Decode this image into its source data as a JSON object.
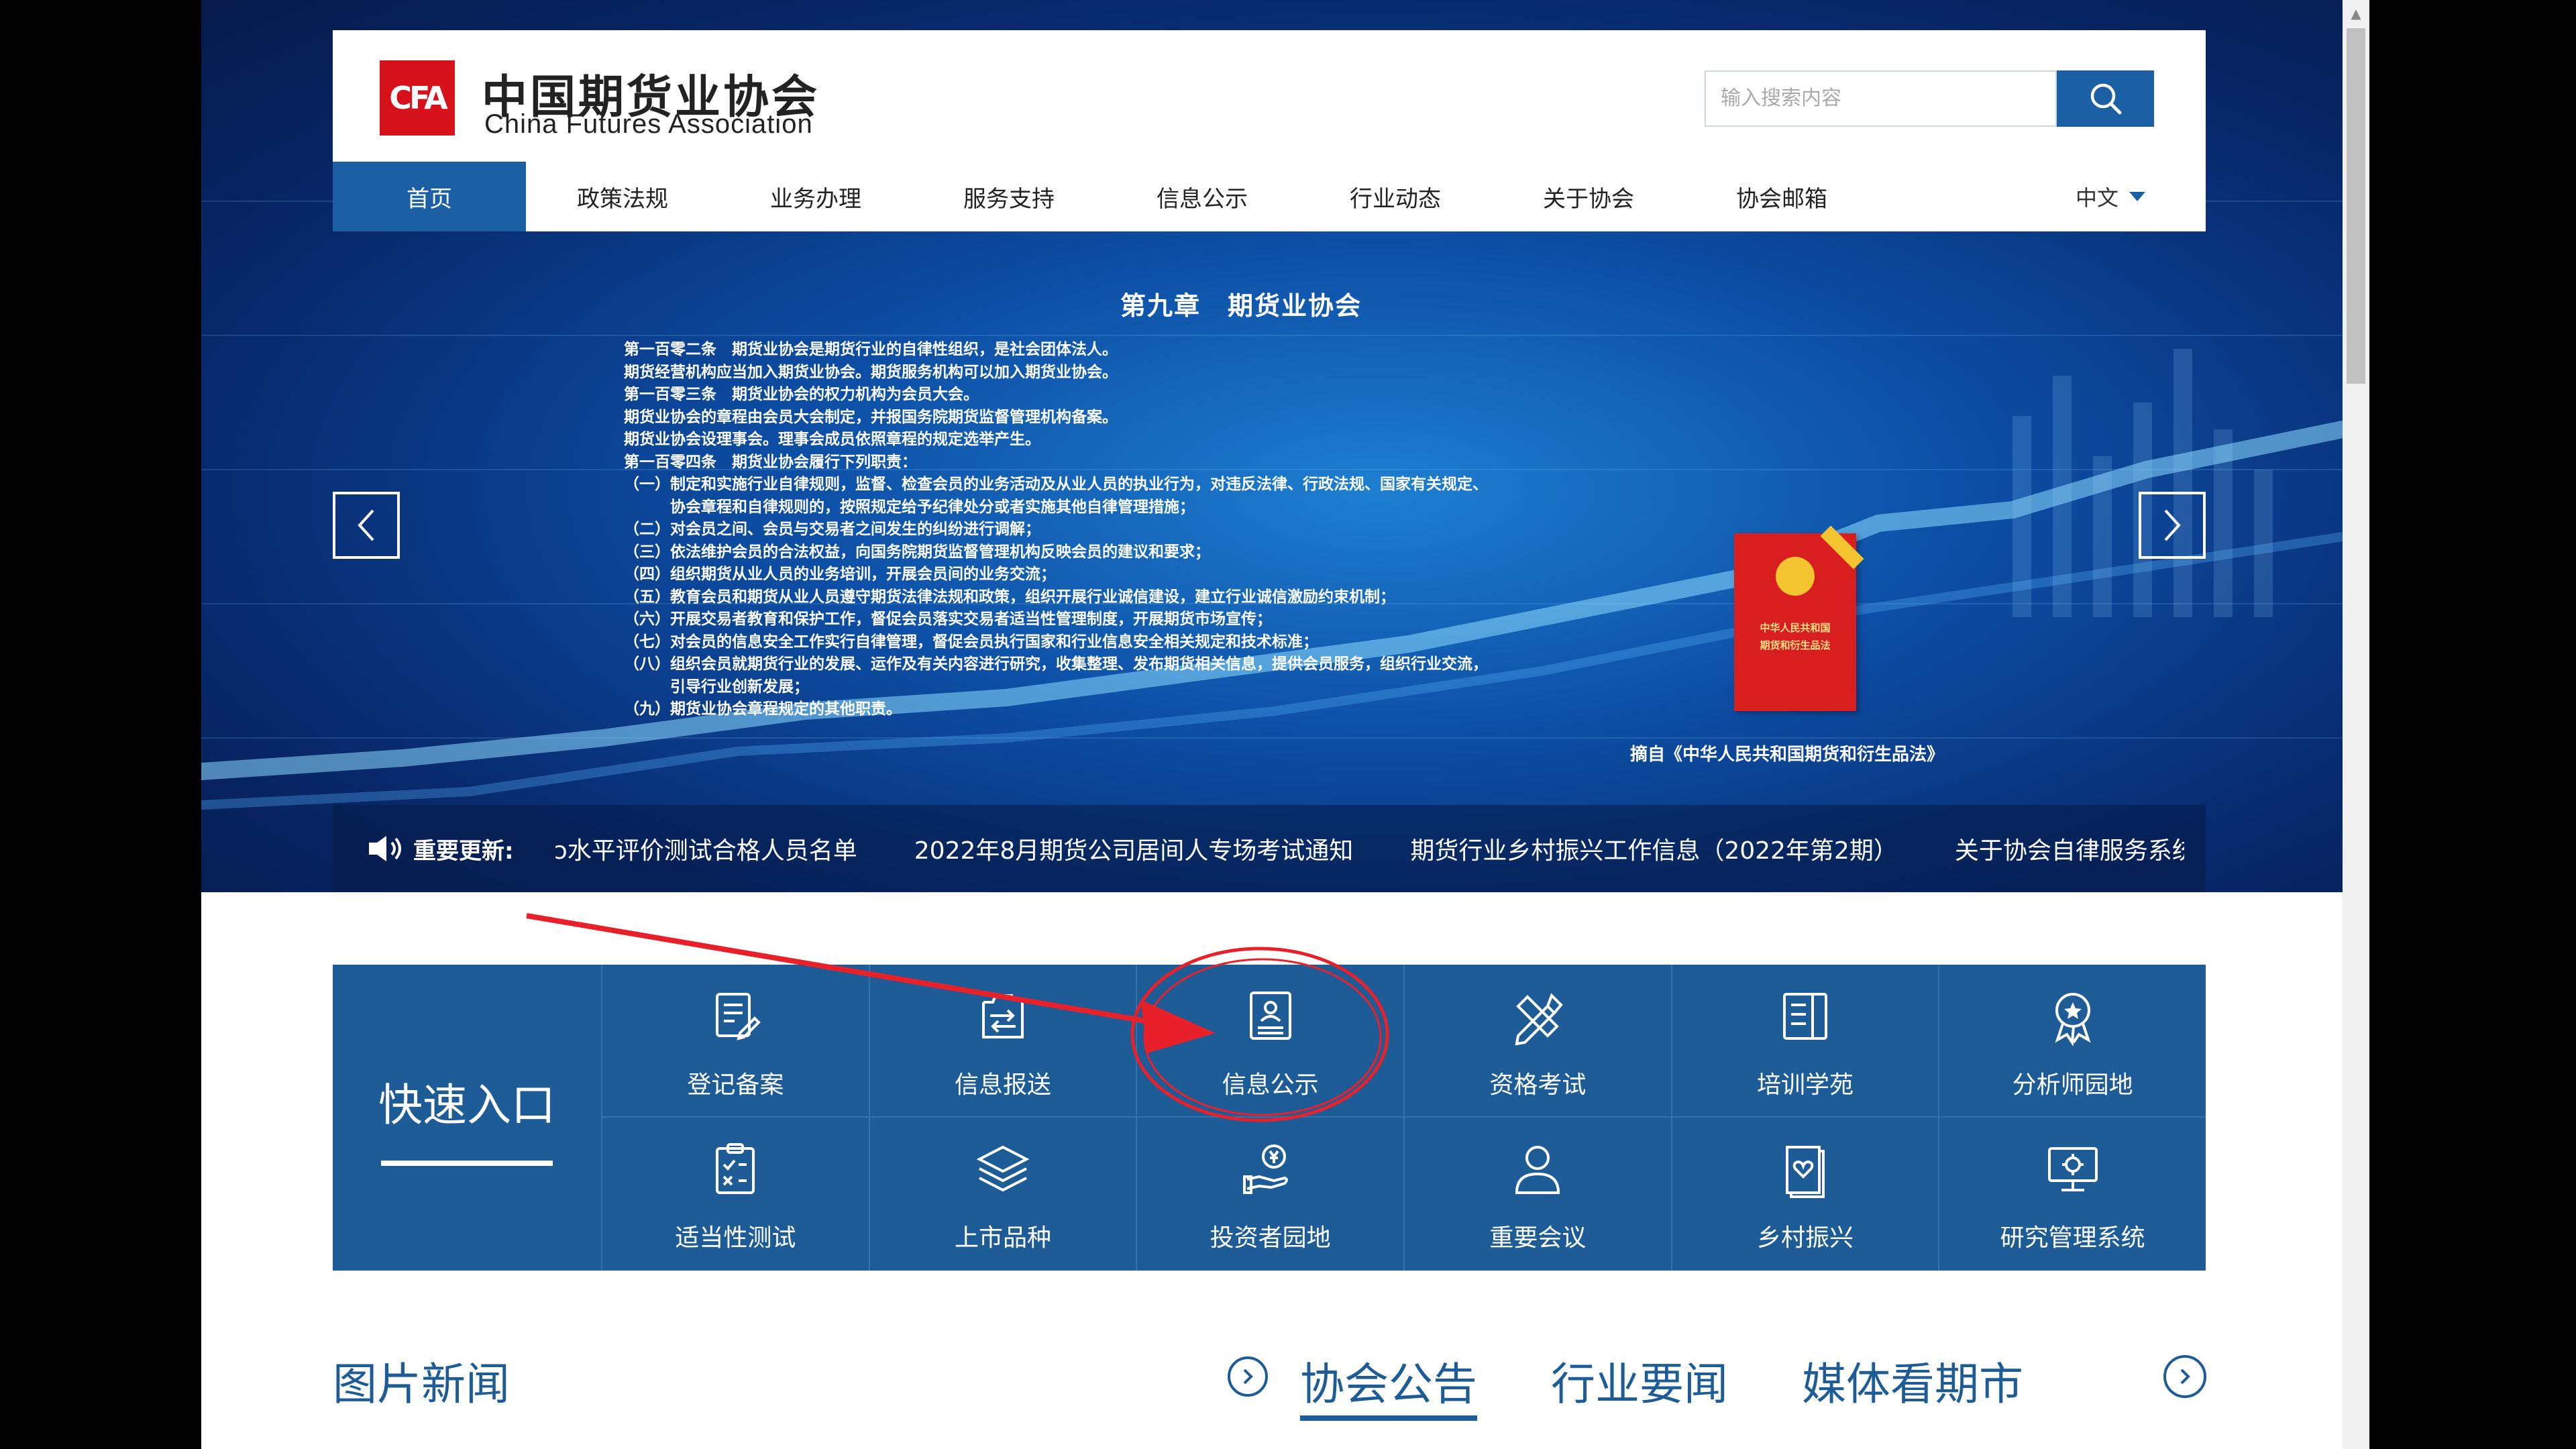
{
  "header": {
    "logo_mark": "CFA",
    "logo_cn": "中国期货业协会",
    "logo_en": "China Futures Association",
    "search_placeholder": "输入搜索内容"
  },
  "nav": {
    "items": [
      "首页",
      "政策法规",
      "业务办理",
      "服务支持",
      "信息公示",
      "行业动态",
      "关于协会",
      "协会邮箱"
    ],
    "active_index": 0,
    "language": "中文"
  },
  "slide": {
    "title": "第九章　期货业协会",
    "lines": [
      "第一百零二条　期货业协会是期货行业的自律性组织，是社会团体法人。",
      "期货经营机构应当加入期货业协会。期货服务机构可以加入期货业协会。",
      "第一百零三条　期货业协会的权力机构为会员大会。",
      "期货业协会的章程由会员大会制定，并报国务院期货监督管理机构备案。",
      "期货业协会设理事会。理事会成员依照章程的规定选举产生。",
      "第一百零四条　期货业协会履行下列职责：",
      "（一）制定和实施行业自律规则，监督、检查会员的业务活动及从业人员的执业行为，对违反法律、行政法规、国家有关规定、",
      "　　　协会章程和自律规则的，按照规定给予纪律处分或者实施其他自律管理措施；",
      "（二）对会员之间、会员与交易者之间发生的纠纷进行调解；",
      "（三）依法维护会员的合法权益，向国务院期货监督管理机构反映会员的建议和要求；",
      "（四）组织期货从业人员的业务培训，开展会员间的业务交流；",
      "（五）教育会员和期货从业人员遵守期货法律法规和政策，组织开展行业诚信建设，建立行业诚信激励约束机制；",
      "（六）开展交易者教育和保护工作，督促会员落实交易者适当性管理制度，开展期货市场宣传；",
      "（七）对会员的信息安全工作实行自律管理，督促会员执行国家和行业信息安全相关规定和技术标准；",
      "（八）组织会员就期货行业的发展、运作及有关内容进行研究，收集整理、发布期货相关信息，提供会员服务，组织行业交流，",
      "　　　引导行业创新发展；",
      "（九）期货业协会章程规定的其他职责。"
    ],
    "book_text": [
      "中华人民共和国",
      "期货和衍生品法"
    ],
    "source": "摘自《中华人民共和国期货和衍生品法》"
  },
  "ticker": {
    "label": "重要更新:",
    "items": [
      "ɔ水平评价测试合格人员名单",
      "2022年8月期货公司居间人专场考试通知",
      "期货行业乡村振兴工作信息（2022年第2期）",
      "关于协会自律服务系统停机维"
    ]
  },
  "quick": {
    "title": "快速入口",
    "items": [
      {
        "label": "登记备案",
        "icon": "register-icon"
      },
      {
        "label": "信息报送",
        "icon": "report-icon"
      },
      {
        "label": "信息公示",
        "icon": "info-disclosure-icon"
      },
      {
        "label": "资格考试",
        "icon": "exam-icon"
      },
      {
        "label": "培训学苑",
        "icon": "training-icon"
      },
      {
        "label": "分析师园地",
        "icon": "analyst-icon"
      },
      {
        "label": "适当性测试",
        "icon": "suitability-icon"
      },
      {
        "label": "上市品种",
        "icon": "layers-icon"
      },
      {
        "label": "投资者园地",
        "icon": "investor-icon"
      },
      {
        "label": "重要会议",
        "icon": "meeting-icon"
      },
      {
        "label": "乡村振兴",
        "icon": "rural-icon"
      },
      {
        "label": "研究管理系统",
        "icon": "research-icon"
      }
    ]
  },
  "news": {
    "title": "图片新闻",
    "tabs": [
      "协会公告",
      "行业要闻",
      "媒体看期市"
    ],
    "active_tab": 0
  },
  "colors": {
    "primary": "#1b5fa4",
    "quick_bg": "#1d5c97",
    "logo_red": "#d7121c",
    "annotation_red": "#e8202a"
  }
}
